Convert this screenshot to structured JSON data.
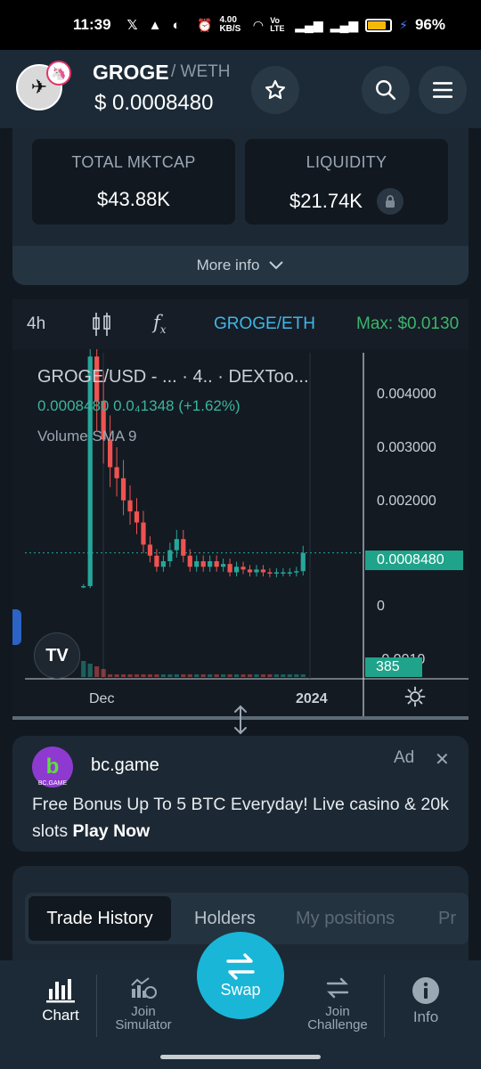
{
  "status_bar": {
    "time": "11:39",
    "net_speed": "4.00 KB/S",
    "network": "Vo LTE",
    "battery": "96%"
  },
  "header": {
    "token_name": "GROGE",
    "token_pair": "/ WETH",
    "price": "$  0.0008480"
  },
  "stats": {
    "total_mktcap_label": "TOTAL MKTCAP",
    "total_mktcap_value": "$43.88K",
    "liquidity_label": "LIQUIDITY",
    "liquidity_value": "$21.74K",
    "more_info": "More info"
  },
  "chart_toolbar": {
    "interval": "4h",
    "fx": "fx",
    "pair": "GROGE/ETH",
    "max": "Max: $0.0130"
  },
  "chart_legend": {
    "title": "GROGE/USD - ...   · 4..  · DEXToo...",
    "values": "0.0008480  0.0₄1348 (+1.62%)",
    "volume": "Volume SMA 9"
  },
  "chart_data": {
    "type": "candlestick",
    "title": "GROGE/USD",
    "y_ticks": [
      "0.004000",
      "0.003000",
      "0.002000",
      "0",
      "-0.0010"
    ],
    "x_ticks": [
      "Dec",
      "2024"
    ],
    "last_price_label": "0.0008480",
    "volume_label": "385",
    "ylim": [
      -0.0012,
      0.0045
    ],
    "series": [
      {
        "name": "price",
        "values": [
          0.00025,
          0.0044,
          0.0036,
          0.0029,
          0.0024,
          0.0022,
          0.0018,
          0.0016,
          0.0014,
          0.001,
          0.0008,
          0.0006,
          0.0007,
          0.0009,
          0.0011,
          0.0008,
          0.0006,
          0.0007,
          0.0006,
          0.0007,
          0.0006,
          0.00065,
          0.0005,
          0.0006,
          0.00055,
          0.0005,
          0.00055,
          0.0005,
          0.00048,
          0.0005,
          0.0005,
          0.0005,
          0.00052,
          0.00085
        ]
      }
    ]
  },
  "ad": {
    "logo_text": "b",
    "logo_sub": "BC.GAME",
    "name": "bc.game",
    "tag": "Ad",
    "close": "✕",
    "text": "Free Bonus Up To 5 BTC Everyday! Live casino & 20k slots",
    "cta": "Play Now"
  },
  "tabs": [
    "Trade History",
    "Holders",
    "My positions",
    "Pr"
  ],
  "bottom_nav": {
    "chart": "Chart",
    "simulator_1": "Join",
    "simulator_2": "Simulator",
    "swap": "Swap",
    "challenge_1": "Join",
    "challenge_2": "Challenge",
    "info": "Info"
  },
  "colors": {
    "accent": "#19b6d8",
    "up": "#26a69a",
    "down": "#ef5350",
    "max_price": "#3bb56b",
    "pair_link": "#41b6e6"
  }
}
